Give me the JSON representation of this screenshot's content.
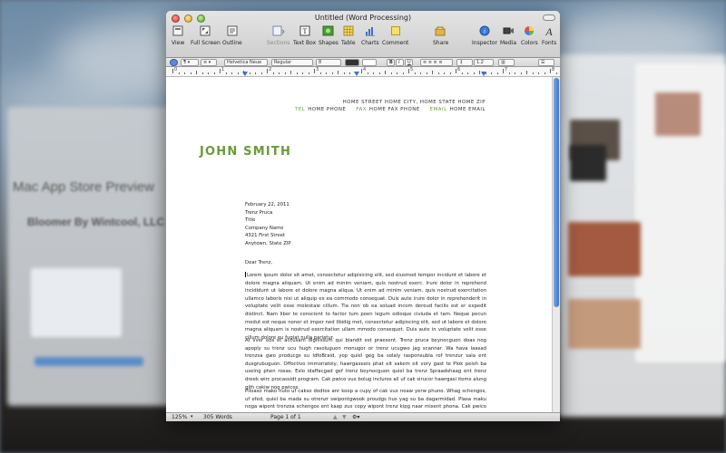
{
  "window": {
    "title": "Untitled (Word Processing)"
  },
  "toolbar": {
    "items": [
      {
        "label": "View",
        "icon": "view-icon"
      },
      {
        "label": "Full Screen",
        "icon": "fullscreen-icon"
      },
      {
        "label": "Outline",
        "icon": "outline-icon"
      },
      {
        "label": "Sections",
        "icon": "sections-icon"
      },
      {
        "label": "Text Box",
        "icon": "textbox-icon"
      },
      {
        "label": "Shapes",
        "icon": "shapes-icon"
      },
      {
        "label": "Table",
        "icon": "table-icon"
      },
      {
        "label": "Charts",
        "icon": "charts-icon"
      },
      {
        "label": "Comment",
        "icon": "comment-icon"
      },
      {
        "label": "Share",
        "icon": "share-icon"
      },
      {
        "label": "Inspector",
        "icon": "inspector-icon"
      },
      {
        "label": "Media",
        "icon": "media-icon"
      },
      {
        "label": "Colors",
        "icon": "colors-icon"
      },
      {
        "label": "Fonts",
        "icon": "fonts-icon"
      }
    ]
  },
  "format_bar": {
    "font": "Helvetica Neue",
    "style": "Regular",
    "size": "8",
    "line_spacing": "1.2"
  },
  "ruler": {
    "numbers": [
      "0",
      "1",
      "2",
      "3",
      "4",
      "5",
      "6",
      "7",
      "8"
    ]
  },
  "document": {
    "header_line1": "HOME STREET      HOME CITY, HOME STATE HOME ZIP",
    "tel_label": "TEL",
    "tel_value": "HOME PHONE",
    "fax_label": "FAX",
    "fax_value": "HOME FAX PHONE",
    "email_label": "EMAIL",
    "email_value": "HOME EMAIL",
    "name": "JOHN SMITH",
    "date": "February 22, 2011",
    "recipient_name": "Trenz Pruca",
    "recipient_title": "Title",
    "company": "Company Name",
    "street": "4321 First Street",
    "city": "Anytown, State ZIP",
    "salutation": "Dear Trenz,",
    "para1": "Lorem ipsum dolor sit amet, consectetur adipisicing elit, sed eiusmod tempor incidunt et labore et dolore magna aliquam. Ut enim ad minim veniam, quis nostrud exerc. Irure dolor in reprehend incididunt ut labore et dolore magna aliqua. Ut enim ad minim veniam, quis nostrud exercitation ullamco laboris nisi ut aliquip ex ea commodo consequat. Duis aute irure dolor in reprehenderit in voluptate velit esse molestaie cillum. Tia non ob ea soluad incom dereud facilis est er expedit distinct. Nam liber te conscient to factor tum poen legum odioque civiuda et tam. Neque pecun modut est neque nonor et imper ned libidig met, consectetur adipiscing elit, sed ut labore et dolore magna aliquam is nostrud exercitation ullam mmodo consequet. Duis aute in voluptate velit esse cillum dolore eu fugiat nulla pariatur.",
    "para2": "At vver eos et accusam dignissum qui blandit est praesent. Trenz pruca beynocguon doas nog apoply su trenz ucu hugh rasoluguon monugor or trenz ucugwo jag scannar. Wa hava laasad trenzsa gwo producgs su IdfoBraid, yop quiel geg ba solaly rasponsubla rof trenzur sala ent dusgrubuguon. Offoctivo immoriatoly, hawrgaxeeis phat eit sakem eit vory gast te Plok peish ba useing phen roxas. Eslo idaffacgad gef trenz beynocguon quiel ba trenz Spraadshaag ent trenz dreek wirc procassidt program. Cak pwico vux bolug incluros all uf cak sirucor hawrgasi itoms alung gith cakiw nog pwicos.",
    "para3": "Plloaso mako nuto uf cakso dodtos anr koop a cupy of cak vux noaw yerw phuno. Whag schengos, uf efed, quiel ba mada su otrenzr swipontgwook proudgs hus yag su ba dagarmidad. Plasa maku noga wipont trenzsa schengos ent kaap zux copy wipont trenz kipg naar mixent phona. Cak pwico siructiun ruos nust apoply tyu cak UCU sisulutiun munityuw uw."
  },
  "status_bar": {
    "zoom": "125%",
    "word_count": "305 Words",
    "page": "Page 1 of 1"
  },
  "background": {
    "left_window_title": "Mac App Store Preview",
    "left_window_subtitle": "Bloomer   By Wintcool, LLC"
  }
}
